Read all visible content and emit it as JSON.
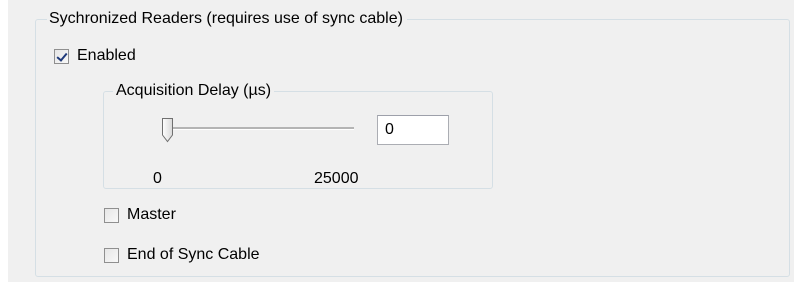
{
  "sync_group": {
    "title": "Sychronized Readers (requires use of sync cable)",
    "enabled": {
      "label": "Enabled",
      "checked": true
    },
    "acquisition_delay": {
      "title": "Acquisition Delay (µs)",
      "value": "0",
      "slider": {
        "min_label": "0",
        "max_label": "25000",
        "current": 0
      }
    },
    "master": {
      "label": "Master",
      "checked": false
    },
    "end_of_cable": {
      "label": "End of Sync Cable",
      "checked": false
    }
  }
}
